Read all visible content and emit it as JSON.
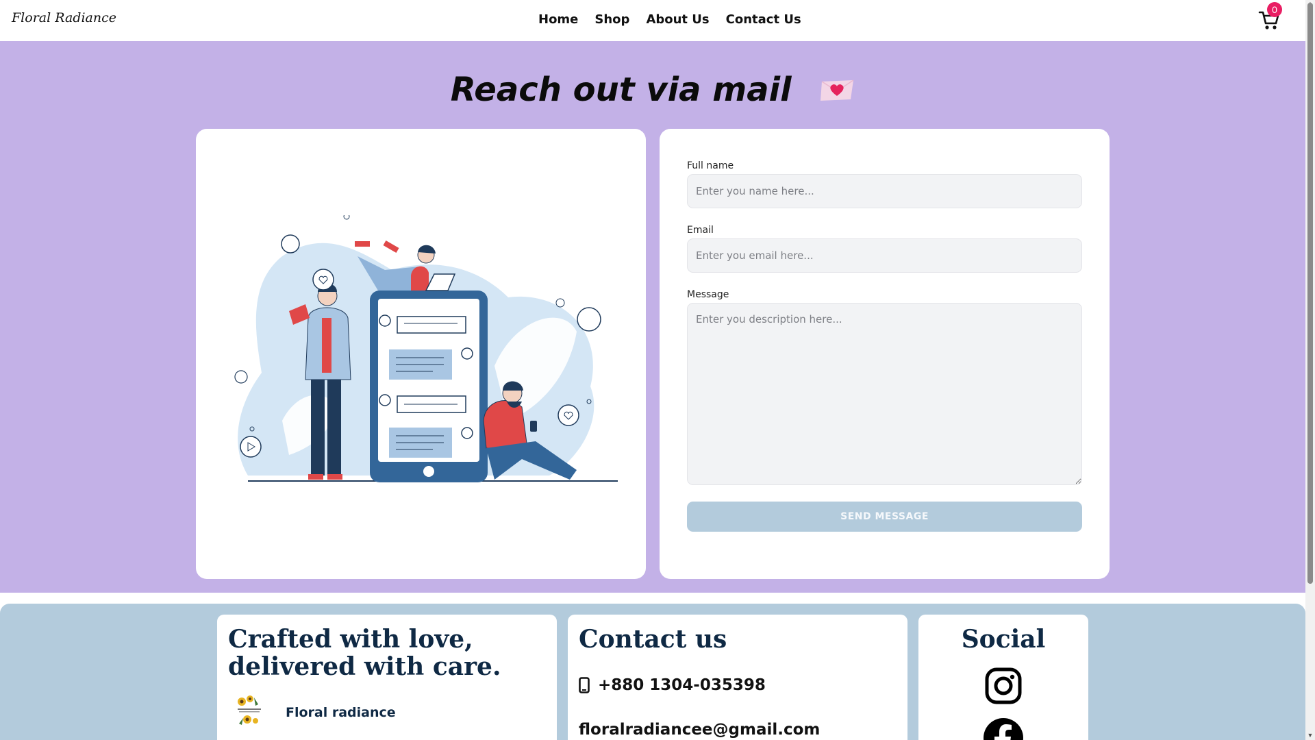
{
  "header": {
    "logo": "Floral Radiance",
    "nav": [
      "Home",
      "Shop",
      "About Us",
      "Contact Us"
    ],
    "cart_count": "0",
    "cart_icon": "cart-icon"
  },
  "hero": {
    "title": "Reach out via mail",
    "title_icon": "love-letter-icon",
    "background": "#c3b1e7"
  },
  "form": {
    "name_label": "Full name",
    "name_placeholder": "Enter you name here...",
    "email_label": "Email",
    "email_placeholder": "Enter you email here...",
    "message_label": "Message",
    "message_placeholder": "Enter you description here...",
    "submit_label": "SEND MESSAGE"
  },
  "footer": {
    "background": "#b3cbdc",
    "tagline": "Crafted with love, delivered with care.",
    "brand_name": "Floral radiance",
    "contact_title": "Contact us",
    "phone": "+880 1304-035398",
    "email": "floralradiancee@gmail.com",
    "social_title": "Social",
    "social_icons": [
      "instagram-icon",
      "facebook-icon"
    ]
  }
}
